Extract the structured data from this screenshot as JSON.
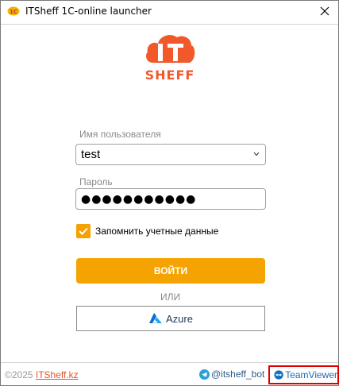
{
  "window": {
    "title": "ITSheff 1C-online launcher",
    "close_glyph": "✕"
  },
  "logo": {
    "text_top": "IT",
    "text_bottom": "SHEFF",
    "color": "#f2592a"
  },
  "form": {
    "username_label": "Имя пользователя",
    "username_value": "test",
    "password_label": "Пароль",
    "password_dots": "●●●●●●●●●●●",
    "remember_label": "Запомнить учетные данные",
    "remember_checked": true,
    "login_button": "ВОЙТИ",
    "or_label": "ИЛИ",
    "azure_button": "Azure"
  },
  "footer": {
    "copyright": "©2025 ",
    "site_link": "ITSheff.kz",
    "telegram": "@itsheff_bot",
    "teamviewer": "TeamViewer"
  },
  "colors": {
    "accent": "#f5a300",
    "brand": "#f2592a",
    "link": "#2d5d8a",
    "highlight_border": "#e00000"
  },
  "icons": {
    "app": "itsheff-app-icon",
    "close": "close-icon",
    "chevron": "chevron-down-icon",
    "check": "checkmark-icon",
    "azure": "azure-icon",
    "telegram": "telegram-icon",
    "teamviewer": "teamviewer-icon"
  }
}
